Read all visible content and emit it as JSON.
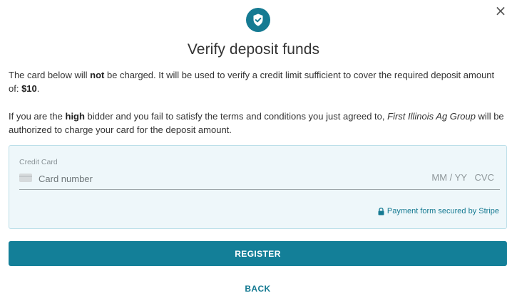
{
  "dialog": {
    "close_glyph": "×",
    "title": "Verify deposit funds",
    "badge_icon": "shield-check-icon",
    "accent_color": "#157a92"
  },
  "paragraph1": {
    "t1": "The card below will ",
    "bold": "not",
    "t2": " be charged. It will be used to verify a credit limit sufficient to cover the required deposit amount of: ",
    "amount": "$10",
    "t3": "."
  },
  "paragraph2": {
    "t1": "If you are the ",
    "bold": "high",
    "t2": " bidder and you fail to satisfy the terms and conditions you just agreed to, ",
    "company": "First Illinois Ag Group",
    "t3": " will be authorized to charge your card for the deposit amount."
  },
  "card_form": {
    "label": "Credit Card",
    "card_number_placeholder": "Card number",
    "expiry_placeholder": "MM / YY",
    "cvc_placeholder": "CVC",
    "secured_text": "Payment form secured by Stripe",
    "lock_icon": "lock-icon",
    "card_icon": "credit-card-icon"
  },
  "actions": {
    "register_label": "REGISTER",
    "back_label": "BACK"
  }
}
